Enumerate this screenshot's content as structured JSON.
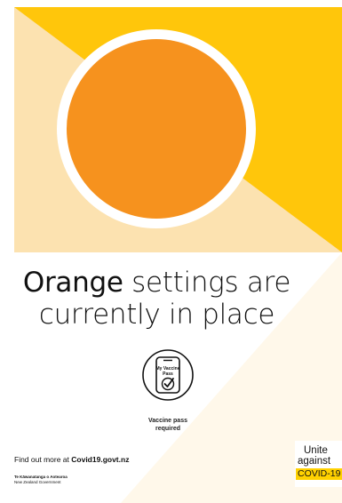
{
  "colors": {
    "yellow": "#FFC60B",
    "cream": "#FCE2B0",
    "orange": "#F6921E",
    "white_ring": "#FFFFFF",
    "tint": "#FFF8EA"
  },
  "headline": {
    "accent": "Orange",
    "rest_line1": " settings are",
    "line2": "currently in place"
  },
  "vaccine_pass": {
    "icon": "vaccine-pass-phone-icon",
    "screen_line1": "My Vaccine",
    "screen_line2": "Pass",
    "caption_line1": "Vaccine pass",
    "caption_line2": "required"
  },
  "footer": {
    "find_out_text": "Find out more at ",
    "link_text": "Covid19.govt.nz",
    "gov_name": "Te Kāwanatanga o Aotearoa",
    "gov_sub": "New Zealand Government"
  },
  "logo": {
    "line1": "Unite",
    "line2": "against",
    "line3": "COVID-19"
  }
}
